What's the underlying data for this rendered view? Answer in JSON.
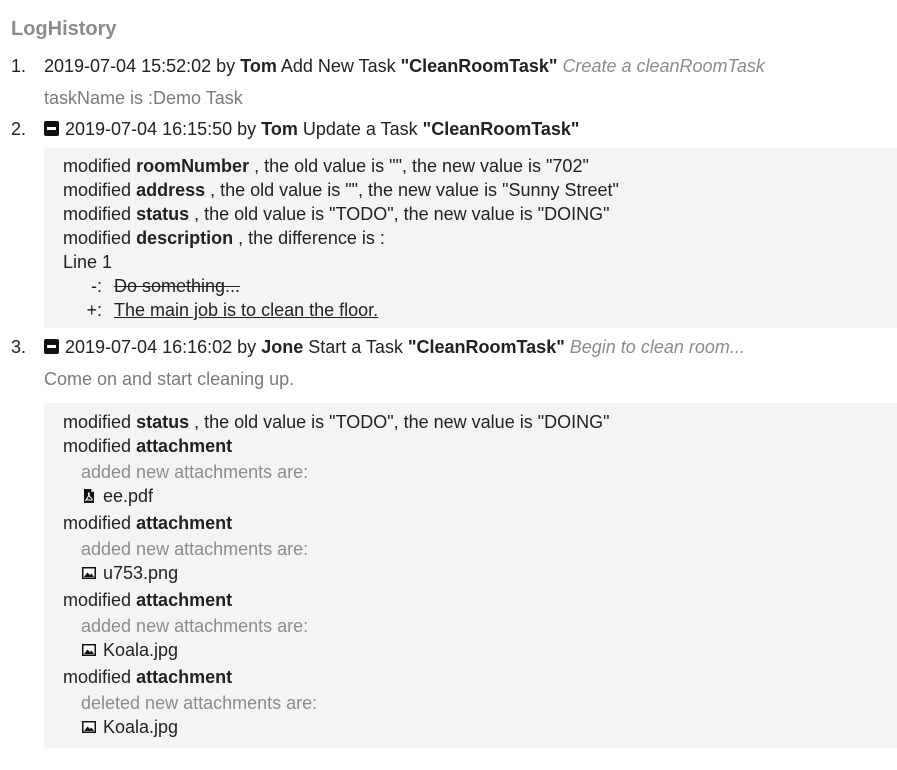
{
  "title": "LogHistory",
  "entries": [
    {
      "num": "1.",
      "timestamp": "2019-07-04 15:52:02",
      "by": "by",
      "user": "Tom",
      "action": "Add New Task",
      "task": "\"CleanRoomTask\"",
      "note": "Create a cleanRoomTask",
      "sub": "taskName is :Demo Task"
    },
    {
      "num": "2.",
      "timestamp": "2019-07-04 16:15:50",
      "by": "by",
      "user": "Tom",
      "action": "Update a Task",
      "task": "\"CleanRoomTask\"",
      "changes": [
        {
          "pre": "modified",
          "field": "roomNumber",
          "text": ", the old value is \"\",  the new value is \"702\""
        },
        {
          "pre": "modified",
          "field": "address",
          "text": ", the old value is \"\",  the new value is \"Sunny Street\""
        },
        {
          "pre": "modified",
          "field": "status",
          "text": ", the old value is \"TODO\",  the new value is \"DOING\""
        },
        {
          "pre": "modified",
          "field": "description",
          "text": ", the difference is :"
        }
      ],
      "diff": {
        "line": "Line 1",
        "minus_sign": "-:",
        "minus_text": "Do something...",
        "plus_sign": "+:",
        "plus_text": "The main job is to clean the floor."
      }
    },
    {
      "num": "3.",
      "timestamp": "2019-07-04 16:16:02",
      "by": "by",
      "user": "Jone",
      "action": "Start a Task",
      "task": "\"CleanRoomTask\"",
      "note": "Begin to clean room...",
      "sub": "Come on and start cleaning up.",
      "status_change": {
        "pre": "modified",
        "field": "status",
        "text": ", the old value is \"TODO\",  the new value is \"DOING\""
      },
      "attachments": [
        {
          "pre": "modified",
          "field": "attachment",
          "label": "added new attachments are:",
          "file": "ee.pdf",
          "icon": "pdf-file-icon"
        },
        {
          "pre": "modified",
          "field": "attachment",
          "label": "added new attachments are:",
          "file": "u753.png",
          "icon": "image-file-icon"
        },
        {
          "pre": "modified",
          "field": "attachment",
          "label": "added new attachments are:",
          "file": "Koala.jpg",
          "icon": "image-file-icon"
        },
        {
          "pre": "modified",
          "field": "attachment",
          "label": "deleted new attachments are:",
          "file": "Koala.jpg",
          "icon": "image-file-icon"
        }
      ]
    }
  ],
  "colors": {
    "box_bg": "#f4f4f4",
    "muted": "#8c8c8c",
    "text": "#222222"
  }
}
